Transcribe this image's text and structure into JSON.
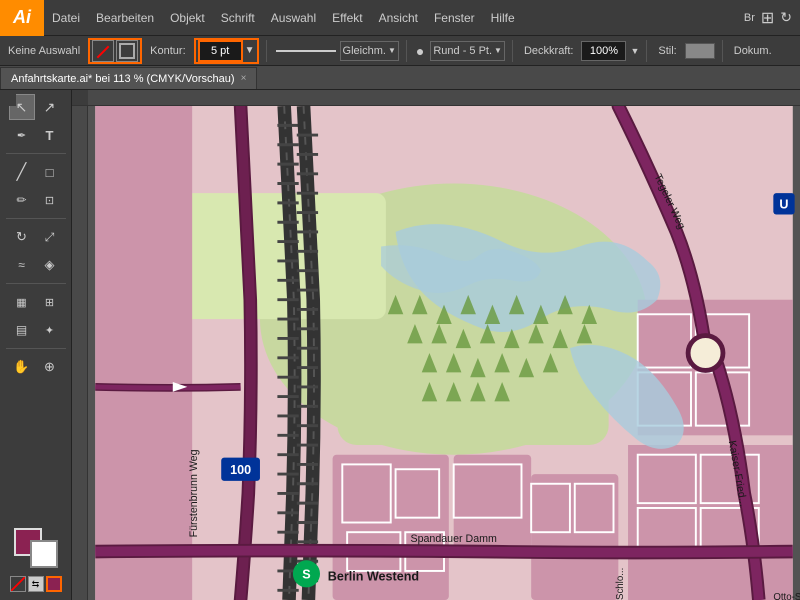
{
  "app": {
    "logo": "Ai",
    "logo_bg": "#ff8c00"
  },
  "menubar": {
    "items": [
      "Datei",
      "Bearbeiten",
      "Objekt",
      "Schrift",
      "Auswahl",
      "Effekt",
      "Ansicht",
      "Fenster",
      "Hilfe"
    ]
  },
  "optionsbar": {
    "selection_label": "Keine Auswahl",
    "fill_label": "",
    "stroke_label": "Kontur:",
    "stroke_value": "5 pt",
    "line_style": "Gleichm.",
    "cap_style": "Rund - 5 Pt.",
    "opacity_label": "Deckkraft:",
    "opacity_value": "100%",
    "style_label": "Stil:",
    "doc_label": "Dokum."
  },
  "tab": {
    "title": "Anfahrtskarte.ai* bei 113 % (CMYK/Vorschau)",
    "close": "×"
  },
  "toolbar": {
    "tools": [
      {
        "name": "select",
        "icon": "↖",
        "active": true
      },
      {
        "name": "direct-select",
        "icon": "↗"
      },
      {
        "name": "pen",
        "icon": "✒"
      },
      {
        "name": "type",
        "icon": "T"
      },
      {
        "name": "line",
        "icon": "╱"
      },
      {
        "name": "rect",
        "icon": "□"
      },
      {
        "name": "pencil",
        "icon": "✏"
      },
      {
        "name": "eraser",
        "icon": "◫"
      },
      {
        "name": "rotate",
        "icon": "↻"
      },
      {
        "name": "scale",
        "icon": "⤢"
      },
      {
        "name": "warp",
        "icon": "≋"
      },
      {
        "name": "gradient",
        "icon": "▤"
      },
      {
        "name": "eyedropper",
        "icon": "✦"
      },
      {
        "name": "blend",
        "icon": "✧"
      },
      {
        "name": "scissors",
        "icon": "✂"
      },
      {
        "name": "hand",
        "icon": "✋"
      },
      {
        "name": "zoom",
        "icon": "⊕"
      }
    ],
    "fill_color": "#8b2252",
    "stroke_color": "#ffffff"
  },
  "map": {
    "title": "Berlin Westend",
    "road_labels": [
      "Fürstenbrunn Weg",
      "Tegeler Weg",
      "Spandauer Damm",
      "Kaiser-Fried...",
      "Otto-S..."
    ],
    "road_number": "100",
    "s_bahn_label": "S",
    "zoom": "113%"
  }
}
